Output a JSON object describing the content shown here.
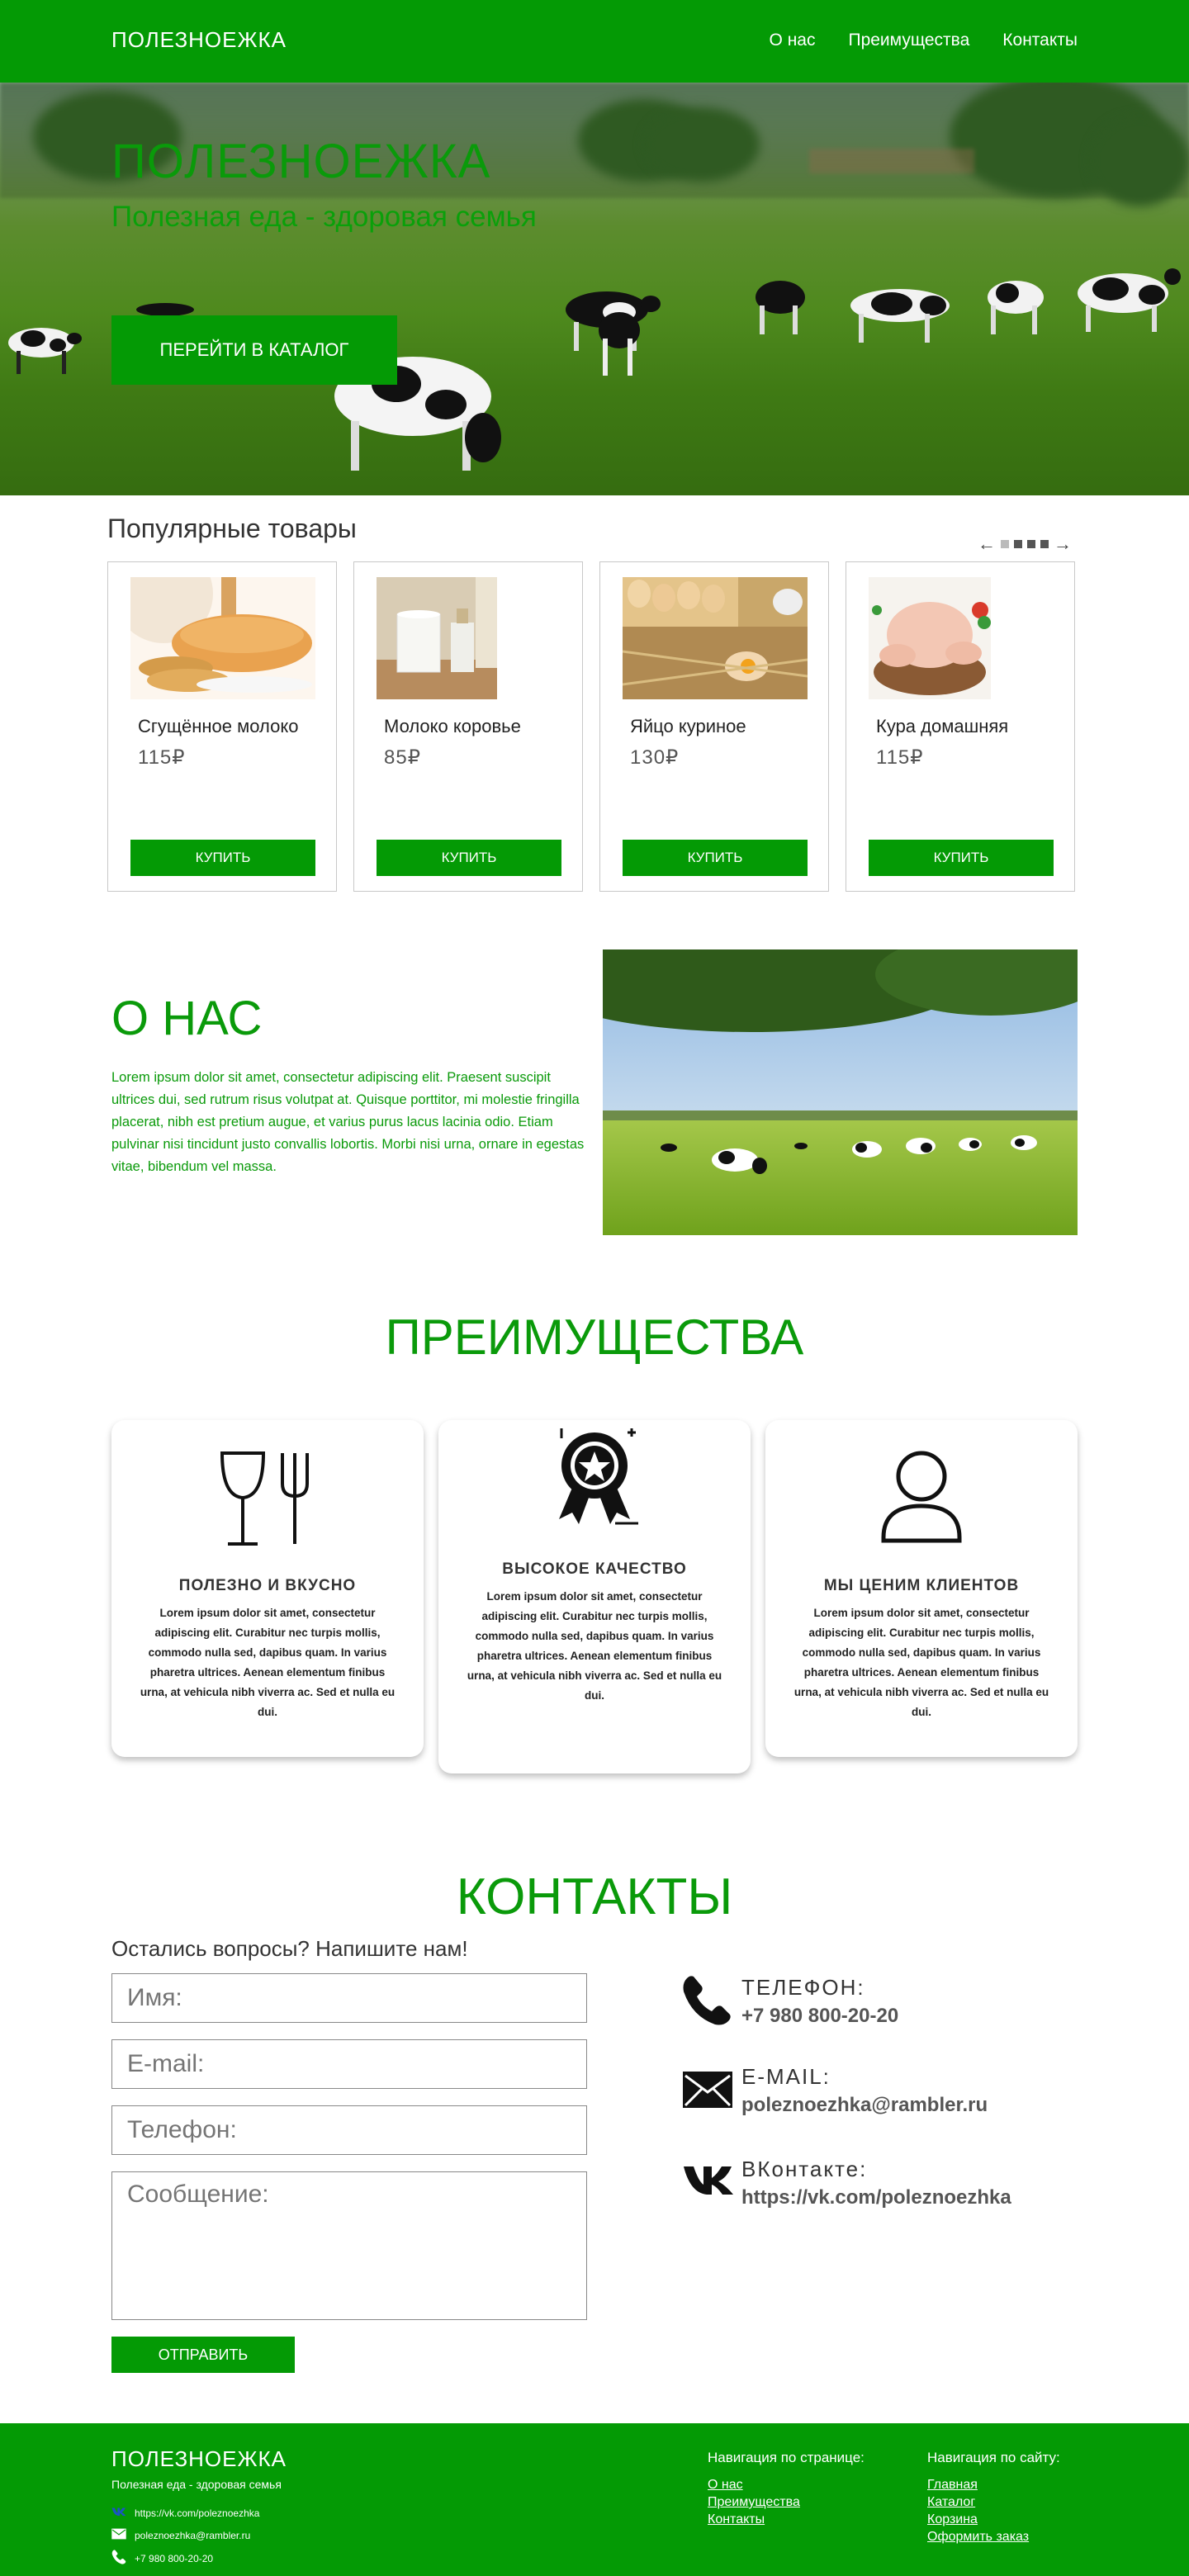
{
  "header": {
    "brand": "ПОЛЕЗНОЕЖКА",
    "nav": [
      "О нас",
      "Преимущества",
      "Контакты"
    ]
  },
  "hero": {
    "title": "ПОЛЕЗНОЕЖКА",
    "subtitle": "Полезная еда - здоровая семья",
    "button": "ПЕРЕЙТИ В КАТАЛОГ"
  },
  "popular": {
    "title": "Популярные товары",
    "prev_icon": "arrow-left-icon",
    "next_icon": "arrow-right-icon",
    "pager_pages": 4,
    "pager_active": 1,
    "products": [
      {
        "name": "Сгущённое молоко",
        "price": "115₽",
        "buy": "КУПИТЬ",
        "image": "condensed-milk-photo"
      },
      {
        "name": "Молоко коровье",
        "price": "85₽",
        "buy": "КУПИТЬ",
        "image": "cow-milk-photo"
      },
      {
        "name": "Яйцо куриное",
        "price": "130₽",
        "buy": "КУПИТЬ",
        "image": "eggs-photo"
      },
      {
        "name": "Кура домашняя",
        "price": "115₽",
        "buy": "КУПИТЬ",
        "image": "chicken-photo"
      }
    ]
  },
  "about": {
    "title": "О НАС",
    "text": "Lorem ipsum dolor sit amet, consectetur adipiscing elit. Praesent suscipit ultrices dui, sed rutrum risus volutpat at. Quisque porttitor, mi molestie fringilla placerat, nibh est pretium augue, et varius purus lacus lacinia odio. Etiam pulvinar nisi tincidunt justo convallis lobortis. Morbi nisi urna, ornare in egestas vitae, bibendum vel massa."
  },
  "advantages": {
    "title": "ПРЕИМУЩЕСТВА",
    "items": [
      {
        "icon": "cutlery-glass-icon",
        "title": "ПОЛЕЗНО И ВКУСНО",
        "text": "Lorem ipsum dolor sit amet, consectetur adipiscing elit. Curabitur nec turpis mollis, commodo nulla sed, dapibus quam. In varius pharetra ultrices. Aenean elementum finibus urna, at vehicula nibh viverra ac. Sed et nulla eu dui."
      },
      {
        "icon": "award-badge-icon",
        "title": "ВЫСОКОЕ КАЧЕСТВО",
        "text": "Lorem ipsum dolor sit amet, consectetur adipiscing elit. Curabitur nec turpis mollis, commodo nulla sed, dapibus quam. In varius pharetra ultrices. Aenean elementum finibus urna, at vehicula nibh viverra ac. Sed et nulla eu dui."
      },
      {
        "icon": "user-icon",
        "title": "МЫ ЦЕНИМ КЛИЕНТОВ",
        "text": "Lorem ipsum dolor sit amet, consectetur adipiscing elit. Curabitur nec turpis mollis, commodo nulla sed, dapibus quam. In varius pharetra ultrices. Aenean elementum finibus urna, at vehicula nibh viverra ac. Sed et nulla eu dui."
      }
    ]
  },
  "contacts": {
    "title": "КОНТАКТЫ",
    "subtitle": "Остались вопросы? Напишите нам!",
    "form": {
      "name_placeholder": "Имя:",
      "email_placeholder": "E-mail:",
      "phone_placeholder": "Телефон:",
      "message_placeholder": "Сообщение:",
      "send": "ОТПРАВИТЬ"
    },
    "info": [
      {
        "icon": "phone-icon",
        "label": "ТЕЛЕФОН:",
        "value": "+7 980 800-20-20"
      },
      {
        "icon": "mail-icon",
        "label": "E-MAIL:",
        "value": "poleznoezhka@rambler.ru"
      },
      {
        "icon": "vk-icon",
        "label": "ВКонтакте:",
        "value": "https://vk.com/poleznoezhka"
      }
    ]
  },
  "footer": {
    "brand": "ПОЛЕЗНОЕЖКА",
    "subtitle": "Полезная еда - здоровая семья",
    "vk": "https://vk.com/poleznoezhka",
    "email": "poleznoezhka@rambler.ru",
    "phone": "+7 980 800-20-20",
    "page_nav_title": "Навигация по странице:",
    "page_nav": [
      "О нас",
      "Преимущества",
      "Контакты"
    ],
    "site_nav_title": "Навигация по сайту:",
    "site_nav": [
      "Главная",
      "Каталог",
      "Корзина",
      "Оформить заказ"
    ]
  },
  "colors": {
    "brand_green": "#049a05",
    "accent_text_green": "#0a9a0a"
  }
}
